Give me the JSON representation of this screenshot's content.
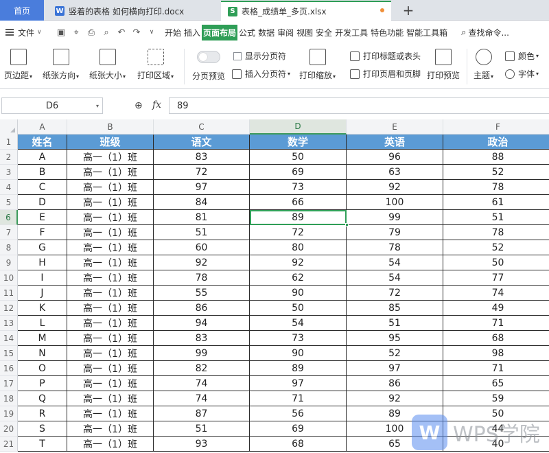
{
  "tabs": {
    "home": "首页",
    "doc": "竖着的表格 如何横向打印.docx",
    "xls": "表格_成绩单_多页.xlsx",
    "add": "+"
  },
  "menu": {
    "file": "文件",
    "tabs": [
      "开始",
      "插入",
      "页面布局",
      "公式",
      "数据",
      "审阅",
      "视图",
      "安全",
      "开发工具",
      "特色功能",
      "智能工具箱"
    ],
    "active_tab": "页面布局",
    "search": "查找命令..."
  },
  "ribbon": {
    "margins": "页边距",
    "orientation": "纸张方向",
    "size": "纸张大小",
    "print_area": "打印区域",
    "page_break_preview": "分页预览",
    "show_page_breaks": "显示分页符",
    "insert_page_break": "插入分页符",
    "print_scaling": "打印缩放",
    "print_titles": "打印标题或表头",
    "header_footer": "打印页眉和页脚",
    "print_preview": "打印预览",
    "theme": "主题",
    "colors": "颜色",
    "fonts": "字体"
  },
  "formula_bar": {
    "name_box": "D6",
    "fx": "fx",
    "value": "89"
  },
  "columns": [
    "A",
    "B",
    "C",
    "D",
    "E",
    "F"
  ],
  "selected_column": "D",
  "selected_row": "6",
  "table": {
    "headers": [
      "姓名",
      "班级",
      "语文",
      "数学",
      "英语",
      "政治"
    ],
    "rows": [
      [
        "A",
        "高一（1）班",
        "83",
        "50",
        "96",
        "88"
      ],
      [
        "B",
        "高一（1）班",
        "72",
        "69",
        "63",
        "52"
      ],
      [
        "C",
        "高一（1）班",
        "97",
        "73",
        "92",
        "78"
      ],
      [
        "D",
        "高一（1）班",
        "84",
        "66",
        "100",
        "61"
      ],
      [
        "E",
        "高一（1）班",
        "81",
        "89",
        "99",
        "51"
      ],
      [
        "F",
        "高一（1）班",
        "51",
        "72",
        "79",
        "78"
      ],
      [
        "G",
        "高一（1）班",
        "60",
        "80",
        "78",
        "52"
      ],
      [
        "H",
        "高一（1）班",
        "92",
        "92",
        "54",
        "50"
      ],
      [
        "I",
        "高一（1）班",
        "78",
        "62",
        "54",
        "77"
      ],
      [
        "J",
        "高一（1）班",
        "55",
        "90",
        "72",
        "74"
      ],
      [
        "K",
        "高一（1）班",
        "86",
        "50",
        "85",
        "49"
      ],
      [
        "L",
        "高一（1）班",
        "94",
        "54",
        "51",
        "71"
      ],
      [
        "M",
        "高一（1）班",
        "83",
        "73",
        "95",
        "68"
      ],
      [
        "N",
        "高一（1）班",
        "99",
        "90",
        "52",
        "98"
      ],
      [
        "O",
        "高一（1）班",
        "82",
        "89",
        "97",
        "71"
      ],
      [
        "P",
        "高一（1）班",
        "74",
        "97",
        "86",
        "65"
      ],
      [
        "Q",
        "高一（1）班",
        "74",
        "71",
        "92",
        "59"
      ],
      [
        "R",
        "高一（1）班",
        "87",
        "56",
        "89",
        "50"
      ],
      [
        "S",
        "高一（1）班",
        "51",
        "69",
        "100",
        "44"
      ],
      [
        "T",
        "高一（1）班",
        "93",
        "68",
        "65",
        "40"
      ]
    ]
  },
  "watermark": {
    "logo": "W",
    "text": "WPS学院"
  },
  "colors": {
    "header_fill": "#5b9bd5",
    "accent": "#2f9e57",
    "home_tab": "#4a7ddc"
  }
}
